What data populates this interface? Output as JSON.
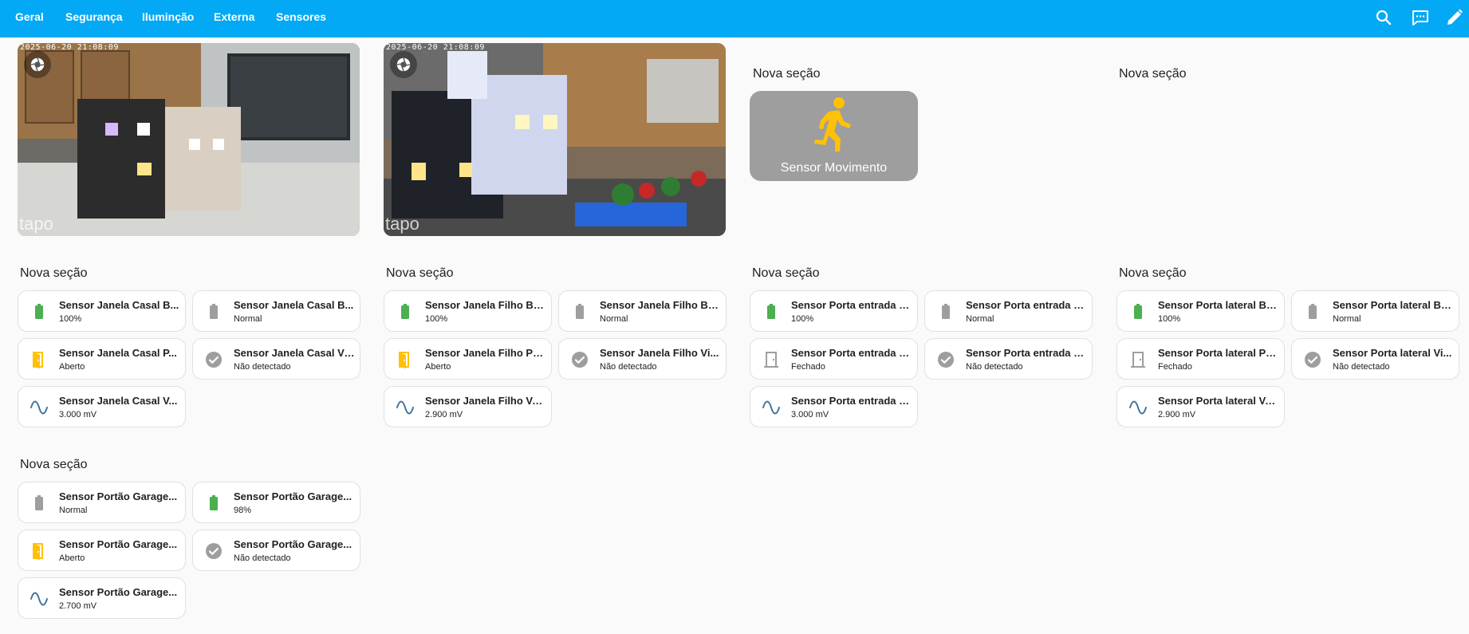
{
  "tabs": [
    "Geral",
    "Segurança",
    "Iluminção",
    "Externa",
    "Sensores"
  ],
  "cameras": [
    {
      "timestamp": "2025-06-20 21:08:09",
      "watermark": "tapo"
    },
    {
      "timestamp": "2025-06-20 21:08:09",
      "watermark": "tapo"
    }
  ],
  "section_title": "Nova seção",
  "motion_tile": {
    "label": "Sensor Movimento",
    "icon": "running-person-icon",
    "color": "#ffc107",
    "background": "#9e9e9e"
  },
  "groups": [
    {
      "title": "Nova seção",
      "tiles": [
        {
          "name": "Sensor Janela Casal B...",
          "state": "100%",
          "icon": "battery-full-icon"
        },
        {
          "name": "Sensor Janela Casal B...",
          "state": "Normal",
          "icon": "battery-icon"
        },
        {
          "name": "Sensor Janela Casal P...",
          "state": "Aberto",
          "icon": "door-open-icon"
        },
        {
          "name": "Sensor Janela Casal Vi...",
          "state": "Não detectado",
          "icon": "check-circle-icon"
        },
        {
          "name": "Sensor Janela Casal V...",
          "state": "3.000 mV",
          "icon": "sine-wave-icon"
        }
      ]
    },
    {
      "title": "Nova seção",
      "tiles": [
        {
          "name": "Sensor Janela Filho Ba...",
          "state": "100%",
          "icon": "battery-full-icon"
        },
        {
          "name": "Sensor Janela Filho Ba...",
          "state": "Normal",
          "icon": "battery-icon"
        },
        {
          "name": "Sensor Janela Filho Po...",
          "state": "Aberto",
          "icon": "door-open-icon"
        },
        {
          "name": "Sensor Janela Filho Vi...",
          "state": "Não detectado",
          "icon": "check-circle-icon"
        },
        {
          "name": "Sensor Janela Filho Vo...",
          "state": "2.900 mV",
          "icon": "sine-wave-icon"
        }
      ]
    },
    {
      "title": "Nova seção",
      "tiles": [
        {
          "name": "Sensor Porta entrada B...",
          "state": "100%",
          "icon": "battery-full-icon"
        },
        {
          "name": "Sensor Porta entrada B...",
          "state": "Normal",
          "icon": "battery-icon"
        },
        {
          "name": "Sensor Porta entrada P...",
          "state": "Fechado",
          "icon": "door-closed-icon"
        },
        {
          "name": "Sensor Porta entrada V...",
          "state": "Não detectado",
          "icon": "check-circle-icon"
        },
        {
          "name": "Sensor Porta entrada V...",
          "state": "3.000 mV",
          "icon": "sine-wave-icon"
        }
      ]
    },
    {
      "title": "Nova seção",
      "tiles": [
        {
          "name": "Sensor Porta lateral Ba...",
          "state": "100%",
          "icon": "battery-full-icon"
        },
        {
          "name": "Sensor Porta lateral Ba...",
          "state": "Normal",
          "icon": "battery-icon"
        },
        {
          "name": "Sensor Porta lateral Po...",
          "state": "Fechado",
          "icon": "door-closed-icon"
        },
        {
          "name": "Sensor Porta lateral Vi...",
          "state": "Não detectado",
          "icon": "check-circle-icon"
        },
        {
          "name": "Sensor Porta lateral Vo...",
          "state": "2.900 mV",
          "icon": "sine-wave-icon"
        }
      ]
    },
    {
      "title": "Nova seção",
      "tiles": [
        {
          "name": "Sensor Portão Garage...",
          "state": "Normal",
          "icon": "battery-icon"
        },
        {
          "name": "Sensor Portão Garage...",
          "state": "98%",
          "icon": "battery-full-icon"
        },
        {
          "name": "Sensor Portão Garage...",
          "state": "Aberto",
          "icon": "door-open-icon"
        },
        {
          "name": "Sensor Portão Garage...",
          "state": "Não detectado",
          "icon": "check-circle-icon"
        },
        {
          "name": "Sensor Portão Garage...",
          "state": "2.700 mV",
          "icon": "sine-wave-icon"
        }
      ]
    }
  ],
  "colors": {
    "header": "#03a9f4",
    "battery_ok": "#4caf50",
    "inactive": "#9e9e9e",
    "open": "#ffc107",
    "voltage": "#44739e"
  }
}
